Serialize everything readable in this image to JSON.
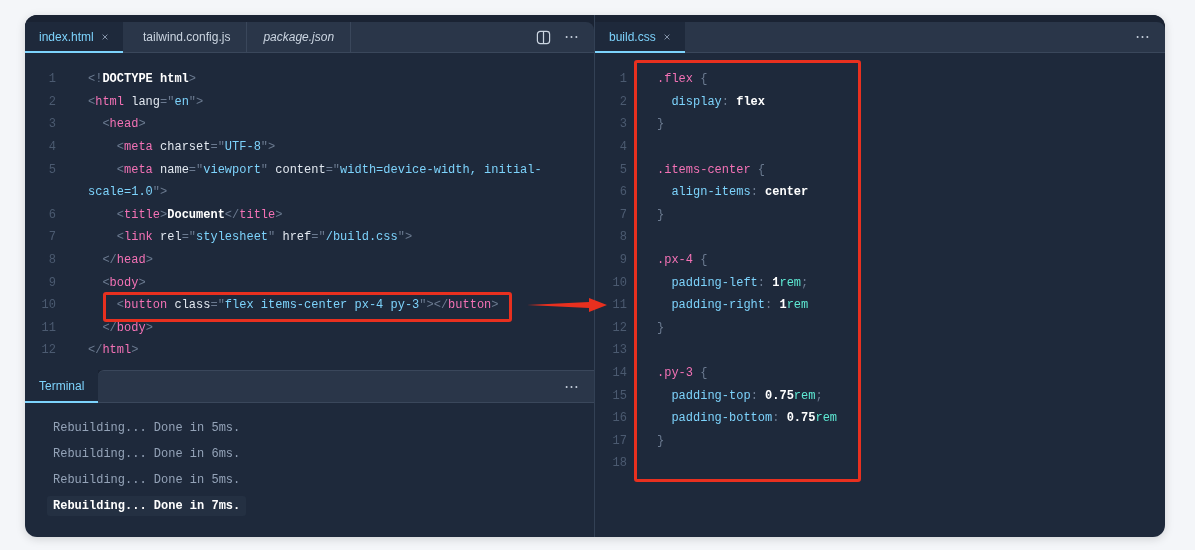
{
  "left_pane": {
    "tabs": [
      {
        "label": "index.html",
        "selected": true,
        "preview": false
      },
      {
        "label": "tailwind.config.js",
        "selected": false,
        "preview": false
      },
      {
        "label": "package.json",
        "selected": false,
        "preview": true
      }
    ],
    "lines": [
      {
        "number": "1",
        "tokens": [
          {
            "kind": "punct",
            "text": "<!"
          },
          {
            "kind": "text",
            "text": "DOCTYPE html"
          },
          {
            "kind": "punct",
            "text": ">"
          }
        ]
      },
      {
        "number": "2",
        "tokens": [
          {
            "kind": "punct",
            "text": "<"
          },
          {
            "kind": "tag",
            "text": "html"
          },
          {
            "kind": "attr",
            "text": " lang"
          },
          {
            "kind": "punct",
            "text": "=\""
          },
          {
            "kind": "string",
            "text": "en"
          },
          {
            "kind": "punct",
            "text": "\">"
          }
        ]
      },
      {
        "number": "3",
        "tokens": [
          {
            "kind": "punct",
            "text": "  <"
          },
          {
            "kind": "tag",
            "text": "head"
          },
          {
            "kind": "punct",
            "text": ">"
          }
        ]
      },
      {
        "number": "4",
        "tokens": [
          {
            "kind": "punct",
            "text": "    <"
          },
          {
            "kind": "tag",
            "text": "meta"
          },
          {
            "kind": "attr",
            "text": " charset"
          },
          {
            "kind": "punct",
            "text": "=\""
          },
          {
            "kind": "string",
            "text": "UTF-8"
          },
          {
            "kind": "punct",
            "text": "\">"
          }
        ]
      },
      {
        "number": "5",
        "tokens": [
          {
            "kind": "punct",
            "text": "    <"
          },
          {
            "kind": "tag",
            "text": "meta"
          },
          {
            "kind": "attr",
            "text": " name"
          },
          {
            "kind": "punct",
            "text": "=\""
          },
          {
            "kind": "string",
            "text": "viewport"
          },
          {
            "kind": "punct",
            "text": "\""
          },
          {
            "kind": "attr",
            "text": " content"
          },
          {
            "kind": "punct",
            "text": "=\""
          },
          {
            "kind": "string",
            "text": "width=device-width, initial-"
          }
        ],
        "continuation": [
          {
            "kind": "string",
            "text": "scale=1.0"
          },
          {
            "kind": "punct",
            "text": "\">"
          }
        ]
      },
      {
        "number": "6",
        "tokens": [
          {
            "kind": "punct",
            "text": "    <"
          },
          {
            "kind": "tag",
            "text": "title"
          },
          {
            "kind": "punct",
            "text": ">"
          },
          {
            "kind": "text",
            "text": "Document"
          },
          {
            "kind": "punct",
            "text": "</"
          },
          {
            "kind": "tag",
            "text": "title"
          },
          {
            "kind": "punct",
            "text": ">"
          }
        ]
      },
      {
        "number": "7",
        "tokens": [
          {
            "kind": "punct",
            "text": "    <"
          },
          {
            "kind": "tag",
            "text": "link"
          },
          {
            "kind": "attr",
            "text": " rel"
          },
          {
            "kind": "punct",
            "text": "=\""
          },
          {
            "kind": "string",
            "text": "stylesheet"
          },
          {
            "kind": "punct",
            "text": "\""
          },
          {
            "kind": "attr",
            "text": " href"
          },
          {
            "kind": "punct",
            "text": "=\""
          },
          {
            "kind": "string",
            "text": "/build.css"
          },
          {
            "kind": "punct",
            "text": "\">"
          }
        ]
      },
      {
        "number": "8",
        "tokens": [
          {
            "kind": "punct",
            "text": "  </"
          },
          {
            "kind": "tag",
            "text": "head"
          },
          {
            "kind": "punct",
            "text": ">"
          }
        ]
      },
      {
        "number": "9",
        "tokens": [
          {
            "kind": "punct",
            "text": "  <"
          },
          {
            "kind": "tag",
            "text": "body"
          },
          {
            "kind": "punct",
            "text": ">"
          }
        ]
      },
      {
        "number": "10",
        "tokens": [
          {
            "kind": "punct",
            "text": "    <"
          },
          {
            "kind": "tag",
            "text": "button"
          },
          {
            "kind": "attr",
            "text": " class"
          },
          {
            "kind": "punct",
            "text": "=\""
          },
          {
            "kind": "string",
            "text": "flex items-center px-4 py-3"
          },
          {
            "kind": "punct",
            "text": "\"></"
          },
          {
            "kind": "tag",
            "text": "button"
          },
          {
            "kind": "punct",
            "text": ">"
          }
        ]
      },
      {
        "number": "11",
        "tokens": [
          {
            "kind": "punct",
            "text": "  </"
          },
          {
            "kind": "tag",
            "text": "body"
          },
          {
            "kind": "punct",
            "text": ">"
          }
        ]
      },
      {
        "number": "12",
        "tokens": [
          {
            "kind": "punct",
            "text": "</"
          },
          {
            "kind": "tag",
            "text": "html"
          },
          {
            "kind": "punct",
            "text": ">"
          }
        ]
      }
    ]
  },
  "terminal": {
    "tab": "Terminal",
    "lines": [
      {
        "text": "Rebuilding... Done in 5ms.",
        "highlighted": false
      },
      {
        "text": "Rebuilding... Done in 6ms.",
        "highlighted": false
      },
      {
        "text": "Rebuilding... Done in 5ms.",
        "highlighted": false
      },
      {
        "text": "Rebuilding... Done in 7ms.",
        "highlighted": true
      }
    ]
  },
  "right_pane": {
    "tabs": [
      {
        "label": "build.css",
        "selected": true,
        "preview": false
      }
    ],
    "lines": [
      {
        "number": "1",
        "tokens": [
          {
            "kind": "selector",
            "text": ".flex"
          },
          {
            "kind": "punct",
            "text": " {"
          }
        ]
      },
      {
        "number": "2",
        "tokens": [
          {
            "kind": "prop",
            "text": "  display"
          },
          {
            "kind": "punct",
            "text": ": "
          },
          {
            "kind": "value",
            "text": "flex"
          }
        ]
      },
      {
        "number": "3",
        "tokens": [
          {
            "kind": "punct",
            "text": "}"
          }
        ]
      },
      {
        "number": "4"
      },
      {
        "number": "5",
        "tokens": [
          {
            "kind": "selector",
            "text": ".items-center"
          },
          {
            "kind": "punct",
            "text": " {"
          }
        ]
      },
      {
        "number": "6",
        "tokens": [
          {
            "kind": "prop",
            "text": "  align-items"
          },
          {
            "kind": "punct",
            "text": ": "
          },
          {
            "kind": "value",
            "text": "center"
          }
        ]
      },
      {
        "number": "7",
        "tokens": [
          {
            "kind": "punct",
            "text": "}"
          }
        ]
      },
      {
        "number": "8"
      },
      {
        "number": "9",
        "tokens": [
          {
            "kind": "selector",
            "text": ".px-4"
          },
          {
            "kind": "punct",
            "text": " {"
          }
        ]
      },
      {
        "number": "10",
        "tokens": [
          {
            "kind": "prop",
            "text": "  padding-left"
          },
          {
            "kind": "punct",
            "text": ": "
          },
          {
            "kind": "value",
            "text": "1"
          },
          {
            "kind": "unit",
            "text": "rem"
          },
          {
            "kind": "punct",
            "text": ";"
          }
        ]
      },
      {
        "number": "11",
        "tokens": [
          {
            "kind": "prop",
            "text": "  padding-right"
          },
          {
            "kind": "punct",
            "text": ": "
          },
          {
            "kind": "value",
            "text": "1"
          },
          {
            "kind": "unit",
            "text": "rem"
          }
        ]
      },
      {
        "number": "12",
        "tokens": [
          {
            "kind": "punct",
            "text": "}"
          }
        ]
      },
      {
        "number": "13"
      },
      {
        "number": "14",
        "tokens": [
          {
            "kind": "selector",
            "text": ".py-3"
          },
          {
            "kind": "punct",
            "text": " {"
          }
        ]
      },
      {
        "number": "15",
        "tokens": [
          {
            "kind": "prop",
            "text": "  padding-top"
          },
          {
            "kind": "punct",
            "text": ": "
          },
          {
            "kind": "value",
            "text": "0.75"
          },
          {
            "kind": "unit",
            "text": "rem"
          },
          {
            "kind": "punct",
            "text": ";"
          }
        ]
      },
      {
        "number": "16",
        "tokens": [
          {
            "kind": "prop",
            "text": "  padding-bottom"
          },
          {
            "kind": "punct",
            "text": ": "
          },
          {
            "kind": "value",
            "text": "0.75"
          },
          {
            "kind": "unit",
            "text": "rem"
          }
        ]
      },
      {
        "number": "17",
        "tokens": [
          {
            "kind": "punct",
            "text": "}"
          }
        ]
      },
      {
        "number": "18"
      }
    ]
  }
}
